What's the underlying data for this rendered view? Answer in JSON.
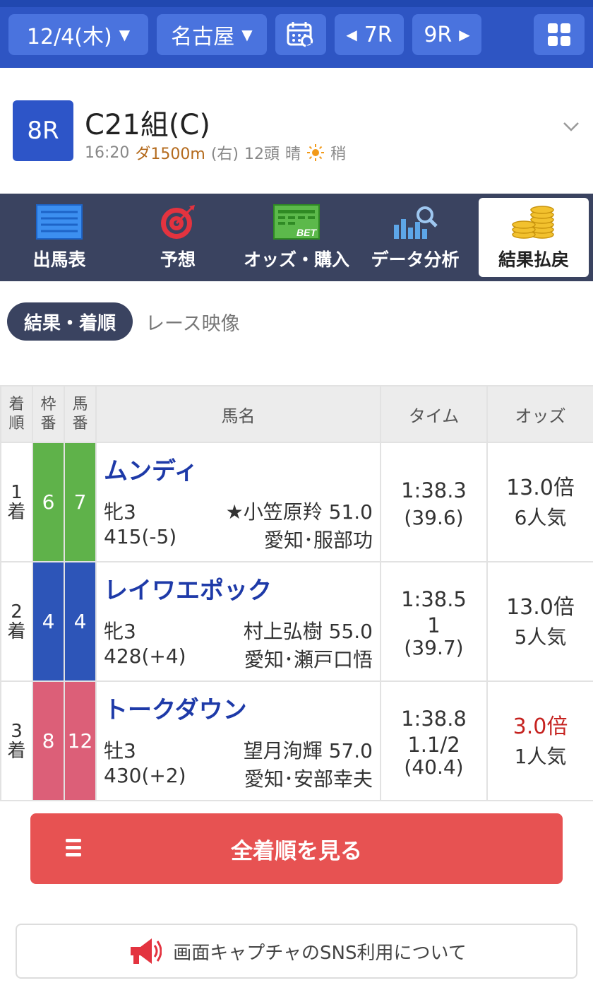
{
  "topbar": {
    "date": "12/4(木)",
    "venue": "名古屋",
    "prev_race": "7R",
    "next_race": "9R"
  },
  "race": {
    "number": "8R",
    "title": "C21組(C)",
    "time": "16:20",
    "distance": "ダ1500m",
    "direction": "(右)",
    "heads": "12頭",
    "weather": "晴",
    "track": "稍"
  },
  "nav": {
    "items": [
      {
        "label": "出馬表",
        "icon": "entry-table-icon"
      },
      {
        "label": "予想",
        "icon": "target-icon"
      },
      {
        "label": "オッズ・購入",
        "icon": "bet-icon"
      },
      {
        "label": "データ分析",
        "icon": "chart-search-icon"
      },
      {
        "label": "結果払戻",
        "icon": "coins-icon"
      }
    ],
    "active_index": 4
  },
  "subtabs": {
    "active": "結果・着順",
    "other": "レース映像"
  },
  "table": {
    "headers": {
      "rank": [
        "着",
        "順"
      ],
      "waku": [
        "枠",
        "番"
      ],
      "umaban": [
        "馬",
        "番"
      ],
      "name": "馬名",
      "time": "タイム",
      "odds": "オッズ"
    },
    "rows": [
      {
        "rank": "1",
        "rank_unit": "着",
        "waku": "6",
        "umaban": "7",
        "waku_color": "#5fb24a",
        "horse": "ムンディ",
        "sex_age": "牝3",
        "jockey": "★小笠原羚 51.0",
        "weight": "415(-5)",
        "trainer": "愛知･服部功",
        "time": "1:38.3",
        "margin": "",
        "last3f": "(39.6)",
        "odds": "13.0倍",
        "popularity": "6人気",
        "favorite": false
      },
      {
        "rank": "2",
        "rank_unit": "着",
        "waku": "4",
        "umaban": "4",
        "waku_color": "#2d55b8",
        "horse": "レイワエポック",
        "sex_age": "牝3",
        "jockey": "村上弘樹 55.0",
        "weight": "428(+4)",
        "trainer": "愛知･瀬戸口悟",
        "time": "1:38.5",
        "margin": "1",
        "last3f": "(39.7)",
        "odds": "13.0倍",
        "popularity": "5人気",
        "favorite": false
      },
      {
        "rank": "3",
        "rank_unit": "着",
        "waku": "8",
        "umaban": "12",
        "waku_color": "#dc5f78",
        "horse": "トークダウン",
        "sex_age": "牡3",
        "jockey": "望月洵輝 57.0",
        "weight": "430(+2)",
        "trainer": "愛知･安部幸夫",
        "time": "1:38.8",
        "margin": "1.1/2",
        "last3f": "(40.4)",
        "odds": "3.0倍",
        "popularity": "1人気",
        "favorite": true
      }
    ]
  },
  "buttons": {
    "all_results": "全着順を見る",
    "sns": "画面キャプチャのSNS利用について"
  },
  "colors": {
    "topbar": "#2e55c3",
    "nav": "#3a4360",
    "horse_name": "#1e3aa8",
    "favorite_odds": "#c5221f",
    "primary_button": "#e75252"
  }
}
